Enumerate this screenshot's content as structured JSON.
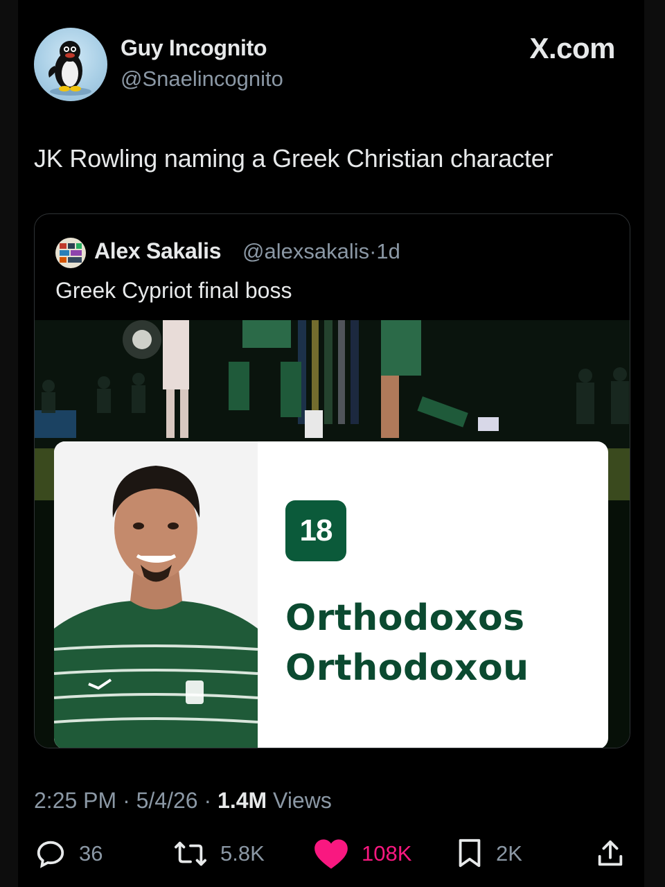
{
  "header": {
    "author_name": "Guy Incognito",
    "author_handle": "@Snaelincognito",
    "brand": "X.com"
  },
  "tweet": {
    "text": "JK Rowling naming a Greek Christian character"
  },
  "quote": {
    "author_name": "Alex Sakalis",
    "author_handle": "@alexsakalis",
    "separator": "·",
    "age": "1d",
    "text": "Greek Cypriot final boss",
    "image": {
      "jersey_number": "18",
      "first_name": "Orthodoxos",
      "last_name": "Orthodoxou"
    }
  },
  "meta": {
    "time": "2:25 PM",
    "date": "5/4/26",
    "views_count": "1.4M",
    "views_label": "Views",
    "separator": "·"
  },
  "actions": {
    "replies": "36",
    "reposts": "5.8K",
    "likes": "108K",
    "bookmarks": "2K"
  },
  "colors": {
    "background": "#000000",
    "text": "#e7e9ea",
    "muted": "#8b98a5",
    "like": "#f91880",
    "card_green": "#0b5a3a"
  },
  "icons": [
    "reply-icon",
    "repost-icon",
    "like-icon",
    "bookmark-icon",
    "share-icon"
  ]
}
